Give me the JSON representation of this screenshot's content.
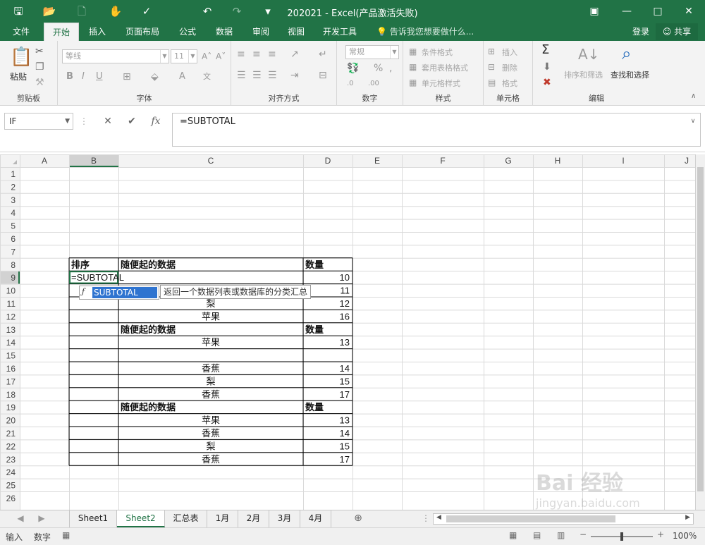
{
  "title": "202021 - Excel(产品激活失败)",
  "tabs": [
    "文件",
    "开始",
    "插入",
    "页面布局",
    "公式",
    "数据",
    "审阅",
    "视图",
    "开发工具"
  ],
  "tell_me": "告诉我您想要做什么...",
  "login": "登录",
  "share": "共享",
  "ribbon": {
    "clipboard": {
      "label": "剪贴板",
      "paste": "粘贴"
    },
    "font": {
      "label": "字体",
      "name": "等线",
      "size": "11",
      "bold": "B",
      "italic": "I",
      "underline": "U"
    },
    "align": {
      "label": "对齐方式"
    },
    "number": {
      "label": "数字",
      "format": "常规"
    },
    "styles": {
      "label": "样式",
      "cond": "条件格式",
      "table": "套用表格格式",
      "cell": "单元格样式"
    },
    "cells": {
      "label": "单元格",
      "insert": "插入",
      "delete": "删除",
      "format": "格式"
    },
    "edit": {
      "label": "编辑",
      "sort": "排序和筛选",
      "find": "查找和选择"
    }
  },
  "namebox": "IF",
  "formula": "=SUBTOTAL",
  "columns": [
    "A",
    "B",
    "C",
    "D",
    "E",
    "F",
    "G",
    "H",
    "I",
    "J"
  ],
  "rows": [
    "1",
    "2",
    "3",
    "4",
    "5",
    "6",
    "7",
    "8",
    "9",
    "10",
    "11",
    "12",
    "13",
    "14",
    "15",
    "16",
    "17",
    "18",
    "19",
    "20",
    "21",
    "22",
    "23",
    "24",
    "25",
    "26"
  ],
  "cells": {
    "B8": "排序",
    "C8": "随便起的数据",
    "D8": "数量",
    "B9": "=SUBTOTAL",
    "D9": "10",
    "D10": "11",
    "C11": "梨",
    "D11": "12",
    "C12": "苹果",
    "D12": "16",
    "C13": "随便起的数据",
    "D13": "数量",
    "C14": "苹果",
    "D14": "13",
    "C16": "香蕉",
    "D16": "14",
    "C17": "梨",
    "D17": "15",
    "C18": "香蕉",
    "D18": "17",
    "C19": "随便起的数据",
    "D19": "数量",
    "C20": "苹果",
    "D20": "13",
    "C21": "香蕉",
    "D21": "14",
    "C22": "梨",
    "D22": "15",
    "C23": "香蕉",
    "D23": "17"
  },
  "autocomplete": {
    "item": "SUBTOTAL",
    "tip": "返回一个数据列表或数据库的分类汇总"
  },
  "sheets": [
    "Sheet1",
    "Sheet2",
    "汇总表",
    "1月",
    "2月",
    "3月",
    "4月"
  ],
  "active_sheet": "Sheet2",
  "status": {
    "mode": "输入",
    "numlock": "数字",
    "zoom": "100%"
  },
  "watermark": {
    "line1": "Bai 经验",
    "line2": "jingyan.baidu.com"
  },
  "colors": {
    "accent": "#217346",
    "selection": "#2f74d0",
    "arrow": "#d9302f"
  }
}
